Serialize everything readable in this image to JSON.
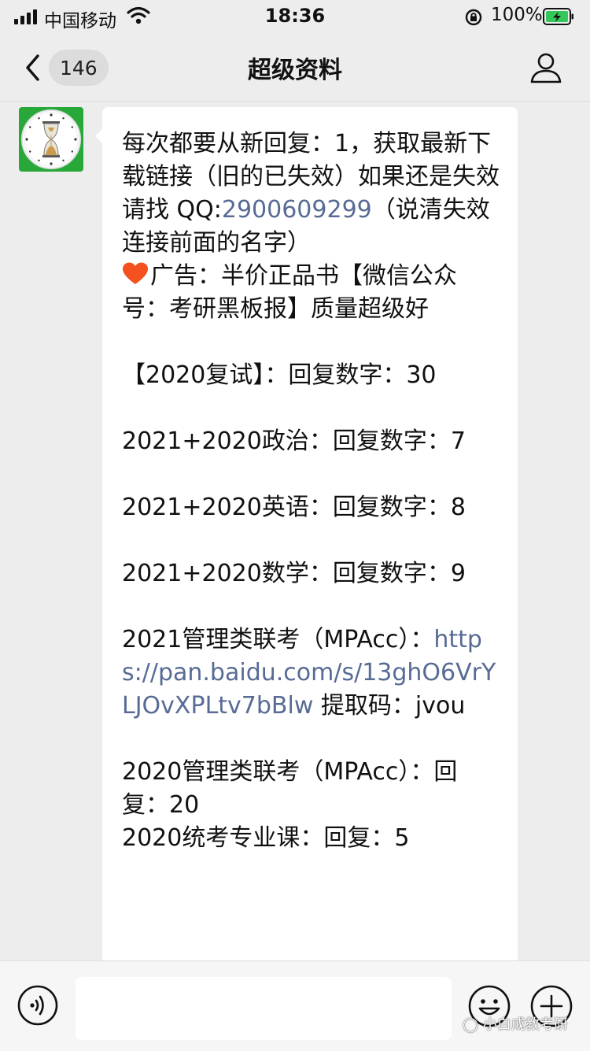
{
  "status_bar": {
    "carrier": "中国移动",
    "time": "18:36",
    "battery": "100%"
  },
  "nav": {
    "unread_count": "146",
    "title": "超级资料"
  },
  "message": {
    "line_1": "每次都要从新回复：1，获取最新下载链接（旧的已失效）如果还是失效请找 QQ:",
    "qq_number": "2900609299",
    "qq_suffix": "（说清失效连接前面的名字）",
    "ad": "广告：半价正品书【微信公众号：考研黑板报】质量超级好",
    "fushi": "【2020复试】：回复数字：30",
    "politics": "2021+2020政治：回复数字：7",
    "english": "2021+2020英语：回复数字：8",
    "math": "2021+2020数学：回复数字：9",
    "mpacc_2021_prefix": "2021管理类联考（MPAcc）：",
    "mpacc_2021_link": "https://pan.baidu.com/s/13ghO6VrYLJOvXPLtv7bBlw",
    "mpacc_2021_code": " 提取码：jvou",
    "mpacc_2020": "2020管理类联考（MPAcc）：回复：20",
    "tongkao_2020": "2020统考专业课：回复：5"
  },
  "watermark": "小白成教考研",
  "colors": {
    "link": "#576b95",
    "background": "#ededed",
    "avatar_green": "#27a838",
    "heart": "#f4511e"
  },
  "icons": {
    "back": "chevron-left-icon",
    "profile": "person-icon",
    "voice": "voice-icon",
    "emoji": "emoji-icon",
    "plus": "plus-icon",
    "heart": "heart-icon"
  }
}
